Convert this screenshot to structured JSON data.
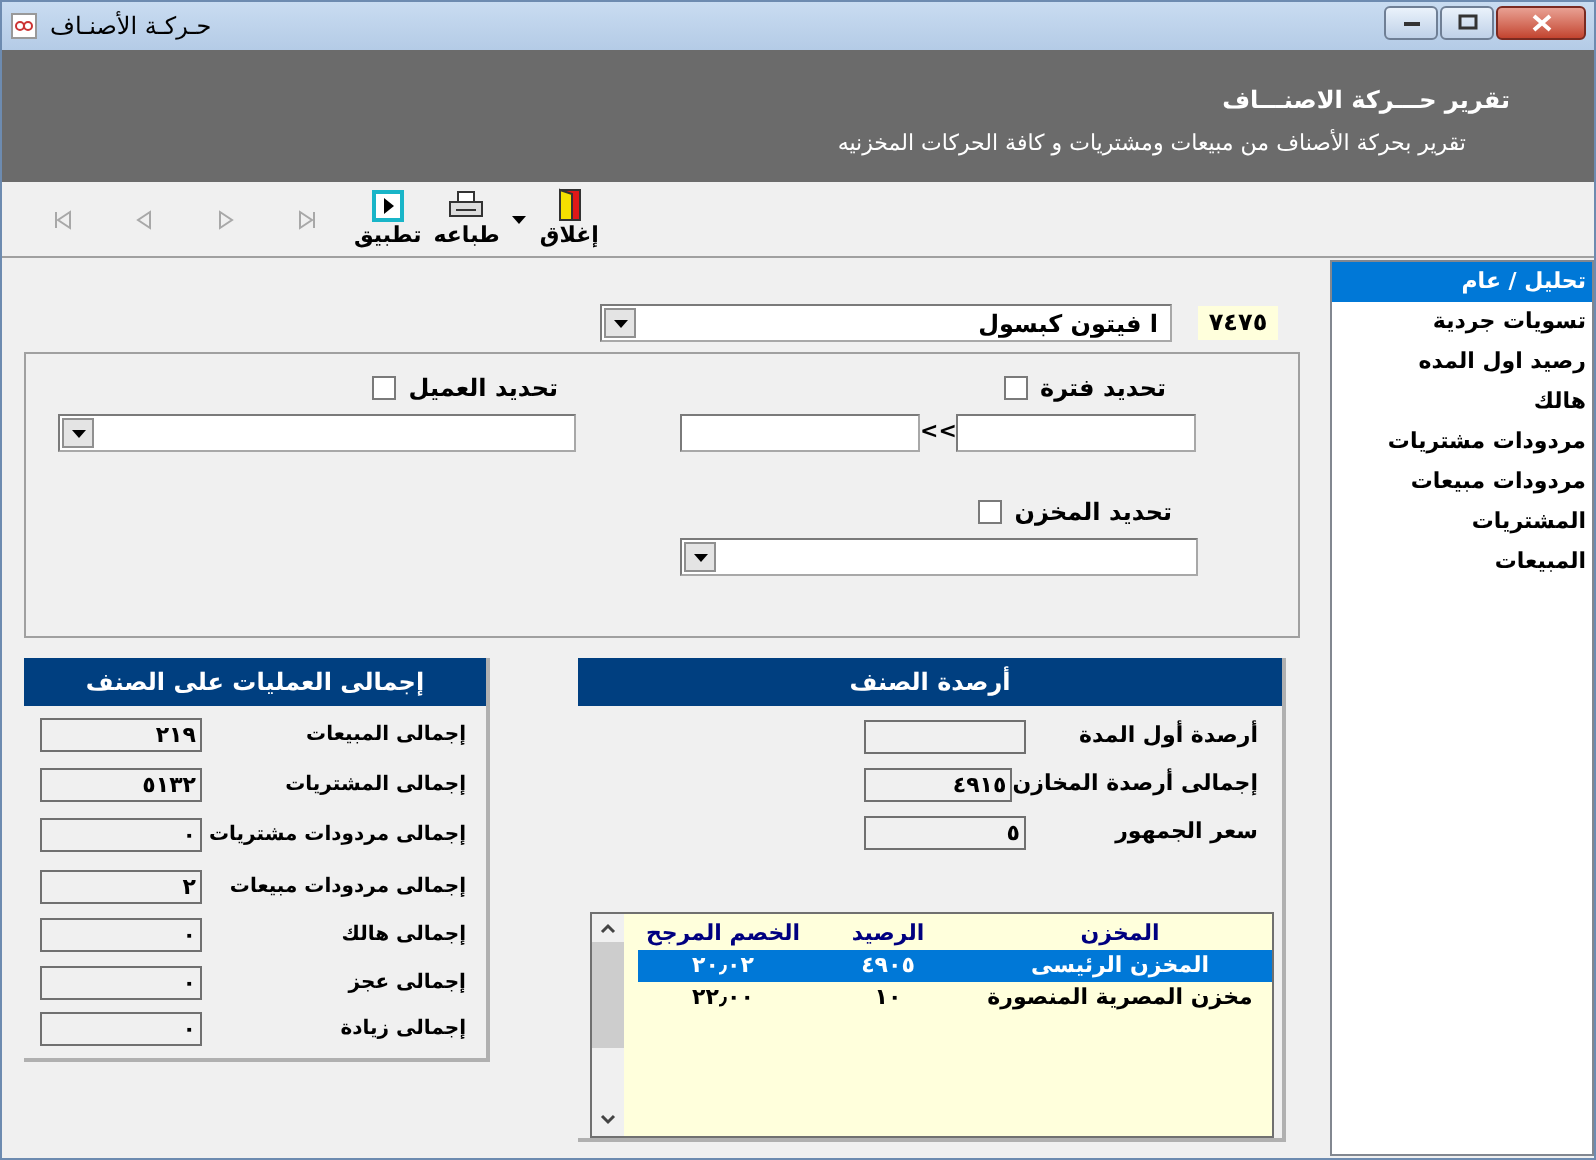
{
  "window": {
    "title": "حـركـة الأصنـاف"
  },
  "header": {
    "title": "تقرير حـــركة الاصنـــاف",
    "subtitle": "تقرير بحركة الأصناف من مبيعات ومشتريات و كافة الحركات المخزنيه"
  },
  "toolbar": {
    "nav_buttons": [
      {
        "kind": "first",
        "disabled": true
      },
      {
        "kind": "prev",
        "disabled": true
      },
      {
        "kind": "next",
        "disabled": true
      },
      {
        "kind": "last",
        "disabled": true
      }
    ],
    "buttons": [
      {
        "kind": "close",
        "label": "إغلاق"
      },
      {
        "kind": "print",
        "label": "طباعه"
      },
      {
        "kind": "apply",
        "label": "تطبيق"
      }
    ]
  },
  "item": {
    "code": "٧٤٧٥",
    "name": "ا فيتون كبسول"
  },
  "filters": {
    "period": {
      "label": "تحديد فترة",
      "checked": false,
      "separator": "<<"
    },
    "customer": {
      "label": "تحديد العميل",
      "checked": false
    },
    "store": {
      "label": "تحديد المخزن",
      "checked": false
    }
  },
  "totals": {
    "title": "إجمالى العمليات على الصنف",
    "rows": [
      {
        "label": "إجمالى المبيعات",
        "value": "٢١٩"
      },
      {
        "label": "إجمالى المشتريات",
        "value": "٥١٣٢"
      },
      {
        "label": "إجمالى مردودات مشتريات",
        "value": "٠"
      },
      {
        "label": "إجمالى مردودات مبيعات",
        "value": "٢"
      },
      {
        "label": "إجمالى هالك",
        "value": "٠"
      },
      {
        "label": "إجمالى عجز",
        "value": "٠"
      },
      {
        "label": "إجمالى زيادة",
        "value": "٠"
      }
    ]
  },
  "balances": {
    "title": "أرصدة الصنف",
    "rows": [
      {
        "label": "أرصدة أول المدة"
      },
      {
        "label": "إجمالى أرصدة المخازن",
        "value": "٤٩١٥"
      },
      {
        "label": "سعر الجمهور",
        "value": "٥"
      }
    ],
    "table": {
      "columns": [
        "المخزن",
        "الرصيد",
        "الخصم المرجح"
      ],
      "rows": [
        {
          "selected": true,
          "cells": [
            "المخزن الرئيسى",
            "٤٩٠٥",
            "٢٠٫٠٢"
          ]
        },
        {
          "selected": false,
          "cells": [
            "مخزن المصرية المنصورة",
            "١٠",
            "٢٢٫٠٠"
          ]
        }
      ]
    }
  },
  "sidebar": {
    "items": [
      {
        "label": "تحليل / عام",
        "selected": true
      },
      {
        "label": "تسويات جردية",
        "selected": false
      },
      {
        "label": "رصيد اول المده",
        "selected": false
      },
      {
        "label": "هالك",
        "selected": false
      },
      {
        "label": "مردودات مشتريات",
        "selected": false
      },
      {
        "label": "مردودات مبيعات",
        "selected": false
      },
      {
        "label": "المشتريات",
        "selected": false
      },
      {
        "label": "المبيعات",
        "selected": false
      }
    ]
  }
}
